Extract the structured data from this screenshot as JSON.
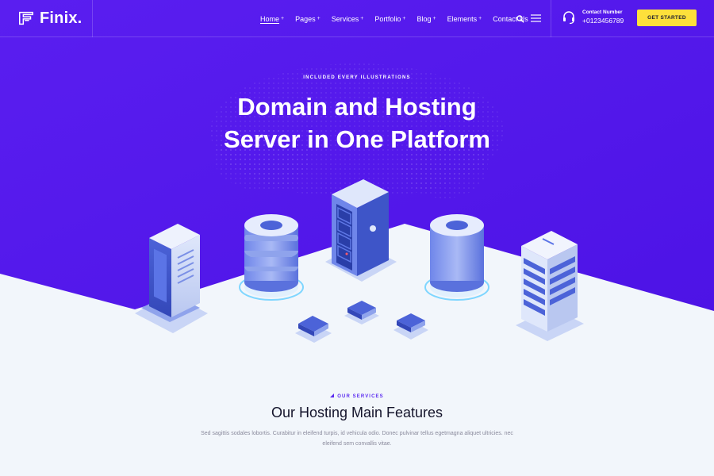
{
  "brand": {
    "name": "Finix."
  },
  "nav": {
    "items": [
      {
        "label": "Home",
        "caret": "+",
        "active": true
      },
      {
        "label": "Pages",
        "caret": "+"
      },
      {
        "label": "Services",
        "caret": "+"
      },
      {
        "label": "Portfolio",
        "caret": "+"
      },
      {
        "label": "Blog",
        "caret": "+"
      },
      {
        "label": "Elements",
        "caret": "+"
      },
      {
        "label": "Contact Us"
      }
    ],
    "icons": [
      "search-icon",
      "hamburger-menu-icon",
      "headset-icon"
    ],
    "contact_label": "Contact Number",
    "contact_number": "+0123456789",
    "cta_label": "GET STARTED"
  },
  "hero": {
    "eyebrow": "INCLUDED EVERY ILLUSTRATIONS",
    "title_line1": "Domain and Hosting",
    "title_line2": "Server in One Platform"
  },
  "services": {
    "eyebrow": "OUR SERVICES",
    "title": "Our Hosting Main Features",
    "text": "Sed sagittis sodales lobortis. Curabitur in eleifend turpis, id vehicula odio. Donec pulvinar tellus egetmagna aliquet ultricies. nec eleifend sem convallis vitae."
  },
  "colors": {
    "hero_purple": "#5e1df0",
    "hero_purple_dark": "#4a18d6",
    "cta_yellow": "#fde03b",
    "floor": "#f2f6fb",
    "accent": "#5b2bf0"
  }
}
